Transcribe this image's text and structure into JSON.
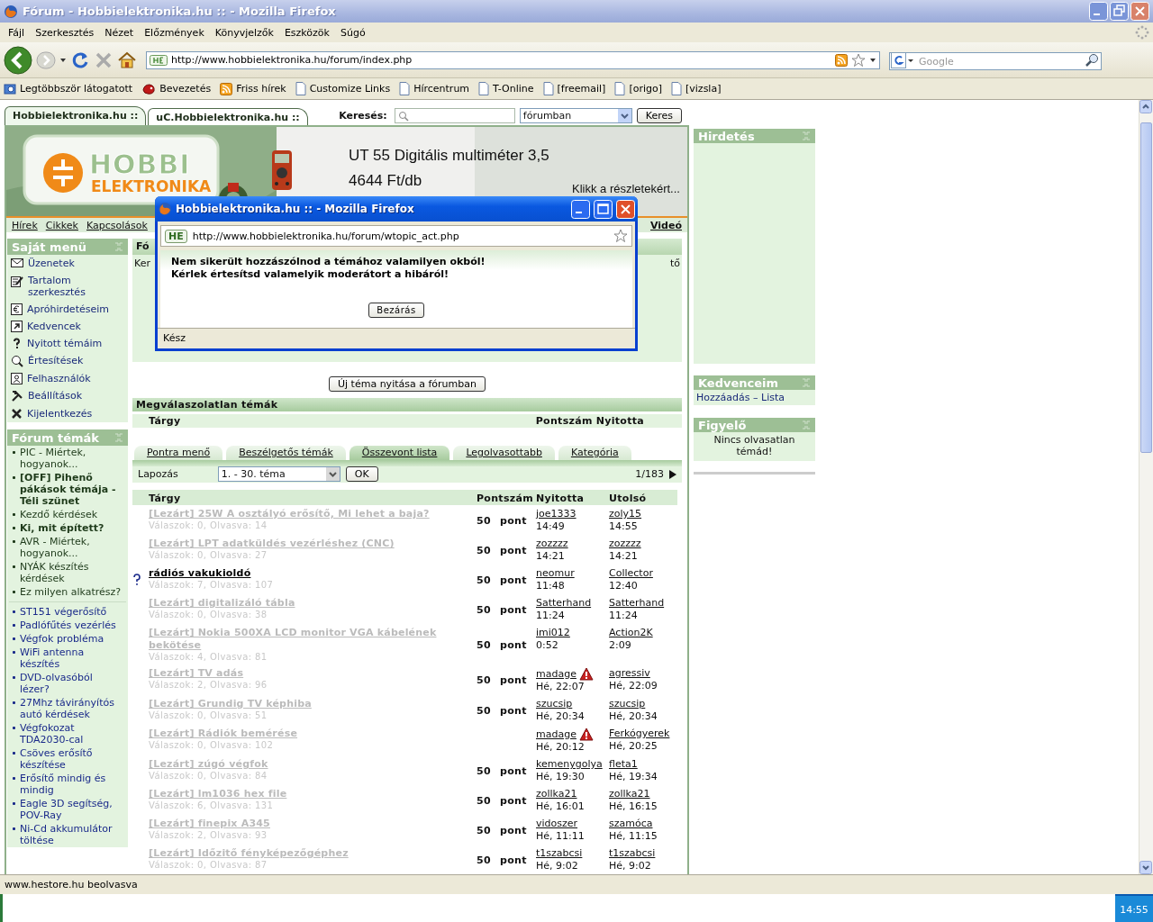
{
  "window": {
    "title": "Fórum - Hobbielektronika.hu :: - Mozilla Firefox"
  },
  "menu": [
    "Fájl",
    "Szerkesztés",
    "Nézet",
    "Előzmények",
    "Könyvjelzők",
    "Eszközök",
    "Súgó"
  ],
  "address": {
    "value": "http://www.hobbielektronika.hu/forum/index.php"
  },
  "search": {
    "placeholder": "Google"
  },
  "bookmarks": [
    {
      "label": "Legtöbbször látogatott",
      "kind": "smart"
    },
    {
      "label": "Bevezetés",
      "kind": "special"
    },
    {
      "label": "Friss hírek",
      "kind": "feed"
    },
    {
      "label": "Customize Links",
      "kind": "page"
    },
    {
      "label": "Hírcentrum",
      "kind": "page"
    },
    {
      "label": "T-Online",
      "kind": "page"
    },
    {
      "label": "[freemail]",
      "kind": "page"
    },
    {
      "label": "[origo]",
      "kind": "page"
    },
    {
      "label": "[vizsla]",
      "kind": "page"
    }
  ],
  "site_tabs": [
    {
      "label": "Hobbielektronika.hu ::",
      "selected": true
    },
    {
      "label": "uC.Hobbielektronika.hu ::",
      "selected": false
    }
  ],
  "site_search": {
    "label": "Keresés:",
    "scope": "fórumban",
    "button": "Keres"
  },
  "banner": {
    "logo_top": "HOBBI",
    "logo_bottom": "ELEKTRONIKA",
    "ad_title": "UT 55 Digitális multiméter 3,5",
    "ad_price": "4644 Ft/db",
    "ad_link": "Klikk a részletekért..."
  },
  "site_nav": {
    "left": [
      "Hírek",
      "Cikkek",
      "Kapcsolások"
    ],
    "right": [
      "Videó"
    ]
  },
  "own_menu": {
    "title": "Saját menü",
    "items": [
      {
        "label": "Üzenetek",
        "kind": "mail"
      },
      {
        "label": "Tartalom szerkesztés",
        "kind": "edit"
      },
      {
        "label": "Apróhirdetéseim",
        "kind": "euro"
      },
      {
        "label": "Kedvencek",
        "kind": "link"
      },
      {
        "label": "Nyitott témáim",
        "kind": "question"
      },
      {
        "label": "Értesítések",
        "kind": "search"
      },
      {
        "label": "Felhasználók",
        "kind": "user"
      },
      {
        "label": "Beállítások",
        "kind": "tools"
      },
      {
        "label": "Kijelentkezés",
        "kind": "logout"
      }
    ]
  },
  "forum_topics": {
    "title": "Fórum témák",
    "pinned": [
      {
        "label": "PIC - Miértek, hogyanok...",
        "bold": false
      },
      {
        "label": "[OFF] Pihenő pákások témája - Téli szünet",
        "bold": true
      },
      {
        "label": "Kezdő kérdések",
        "bold": false
      },
      {
        "label": "Ki, mit épített?",
        "bold": true
      },
      {
        "label": "AVR - Miértek, hogyanok...",
        "bold": false
      },
      {
        "label": "NYÁK készítés kérdések",
        "bold": false
      },
      {
        "label": "Ez milyen alkatrész?",
        "bold": false
      }
    ],
    "recent": [
      "ST151 végerősítő",
      "Padlófűtés vezérlés",
      "Végfok probléma",
      "WiFi antenna készítés",
      "DVD-olvasóból lézer?",
      "27Mhz távirányítós autó kérdések",
      "Végfokozat TDA2030-cal",
      "Csöves erősítő készítése",
      "Erősítő mindig és mindig",
      "Eagle 3D segítség, POV-Ray",
      "Ni-Cd akkumulátor töltése"
    ]
  },
  "forum_box": {
    "title": "Fó",
    "text_left": "Ker",
    "text_right": "tő"
  },
  "new_topic_button": "Új téma nyitása a fórumban",
  "unanswered": {
    "title": "Megválaszolatlan témák",
    "columns": [
      "Tárgy",
      "Pontszám",
      "Nyitotta"
    ]
  },
  "list_tabs": [
    {
      "label": "Pontra menő",
      "selected": false
    },
    {
      "label": "Beszélgetős témák",
      "selected": false
    },
    {
      "label": "Összevont lista",
      "selected": true
    },
    {
      "label": "Legolvasottabb",
      "selected": false
    },
    {
      "label": "Kategória",
      "selected": false
    }
  ],
  "paging": {
    "label": "Lapozás",
    "range": "1. - 30. téma",
    "button": "OK",
    "page": "1/183"
  },
  "topics": {
    "columns": [
      "Tárgy",
      "Pontszám",
      "Nyitotta",
      "Utolsó"
    ],
    "rows": [
      {
        "title": "[Lezárt] 25W A osztályó erősítő, Mi lehet a baja?",
        "locked": true,
        "stats": "Válaszok: 0, Olvasva: 14",
        "points": "50 pont",
        "opener": "joe1333",
        "opened": "14:49",
        "warning": false,
        "last": "zoly15",
        "last_time": "14:55"
      },
      {
        "title": "[Lezárt] LPT adatküldés vezérléshez (CNC)",
        "locked": true,
        "stats": "Válaszok: 0, Olvasva: 27",
        "points": "50 pont",
        "opener": "zozzzz",
        "opened": "14:21",
        "warning": false,
        "last": "zozzzz",
        "last_time": "14:21"
      },
      {
        "title": "rádiós vakukioldó",
        "locked": false,
        "stats": "Válaszok: 7, Olvasva: 107",
        "points": "50 pont",
        "opener": "neomur",
        "opened": "11:48",
        "warning": false,
        "last": "Collector",
        "last_time": "12:40"
      },
      {
        "title": "[Lezárt] digitalizáló tábla",
        "locked": true,
        "stats": "Válaszok: 0, Olvasva: 38",
        "points": "50 pont",
        "opener": "Satterhand",
        "opened": "11:24",
        "warning": false,
        "last": "Satterhand",
        "last_time": "11:24"
      },
      {
        "title": "[Lezárt] Nokia 500XA LCD monitor VGA kábelének bekötése",
        "locked": true,
        "stats": "Válaszok: 4, Olvasva: 81",
        "points": "50 pont",
        "opener": "imi012",
        "opened": "0:52",
        "warning": false,
        "last": "Action2K",
        "last_time": "2:09"
      },
      {
        "title": "[Lezárt] TV adás",
        "locked": true,
        "stats": "Válaszok: 2, Olvasva: 96",
        "points": "50 pont",
        "opener": "madage",
        "opened": "Hé, 22:07",
        "warning": true,
        "last": "agressiv",
        "last_time": "Hé, 22:09"
      },
      {
        "title": "[Lezárt] Grundig TV képhiba",
        "locked": true,
        "stats": "Válaszok: 0, Olvasva: 51",
        "points": "50 pont",
        "opener": "szucsip",
        "opened": "Hé, 20:34",
        "warning": false,
        "last": "szucsip",
        "last_time": "Hé, 20:34"
      },
      {
        "title": "[Lezárt] Rádiók bemérése",
        "locked": true,
        "stats": "Válaszok: 0, Olvasva: 102",
        "opener": "madage",
        "opened": "Hé, 20:12",
        "warning": true,
        "last": "Ferkógyerek",
        "last_time": "Hé, 20:25"
      },
      {
        "title": "[Lezárt] zúgó végfok",
        "locked": true,
        "stats": "Válaszok: 0, Olvasva: 84",
        "points": "50 pont",
        "opener": "kemenygolya",
        "opened": "Hé, 19:30",
        "warning": false,
        "last": "fleta1",
        "last_time": "Hé, 19:34"
      },
      {
        "title": "[Lezárt] lm1036 hex file",
        "locked": true,
        "stats": "Válaszok: 6, Olvasva: 131",
        "points": "50 pont",
        "opener": "zollka21",
        "opened": "Hé, 16:01",
        "warning": false,
        "last": "zollka21",
        "last_time": "Hé, 16:15"
      },
      {
        "title": "[Lezárt] finepix A345",
        "locked": true,
        "stats": "Válaszok: 2, Olvasva: 93",
        "points": "50 pont",
        "opener": "vidoszer",
        "opened": "Hé, 11:11",
        "warning": false,
        "last": "szamóca",
        "last_time": "Hé, 11:15"
      },
      {
        "title": "[Lezárt] Időzitő fényképezőgéphez",
        "locked": true,
        "stats": "Válaszok: 0, Olvasva: 87",
        "points": "50 pont",
        "opener": "t1szabcsi",
        "opened": "Hé, 9:02",
        "warning": false,
        "last": "t1szabcsi",
        "last_time": "Hé, 9:02"
      }
    ]
  },
  "ad_panel": {
    "title": "Hirdetés"
  },
  "favorites": {
    "title": "Kedvenceim",
    "links": [
      "Hozzáadás",
      "Lista"
    ],
    "separator": "–"
  },
  "watcher": {
    "title": "Figyelő",
    "text": "Nincs olvasatlan témád!"
  },
  "popup": {
    "title": "Hobbielektronika.hu :: - Mozilla Firefox",
    "site_badge": "HE",
    "url": "http://www.hobbielektronika.hu/forum/wtopic_act.php",
    "message_lines": [
      "Nem sikerült hozzászólnod a témához valamilyen okból!",
      "Kérlek értesítsd valamelyik moderátort a hibáról!"
    ],
    "button": "Bezárás",
    "status": "Kész"
  },
  "status_bar": "www.hestore.hu beolvasva",
  "taskbar": {
    "clock": "14:55"
  }
}
